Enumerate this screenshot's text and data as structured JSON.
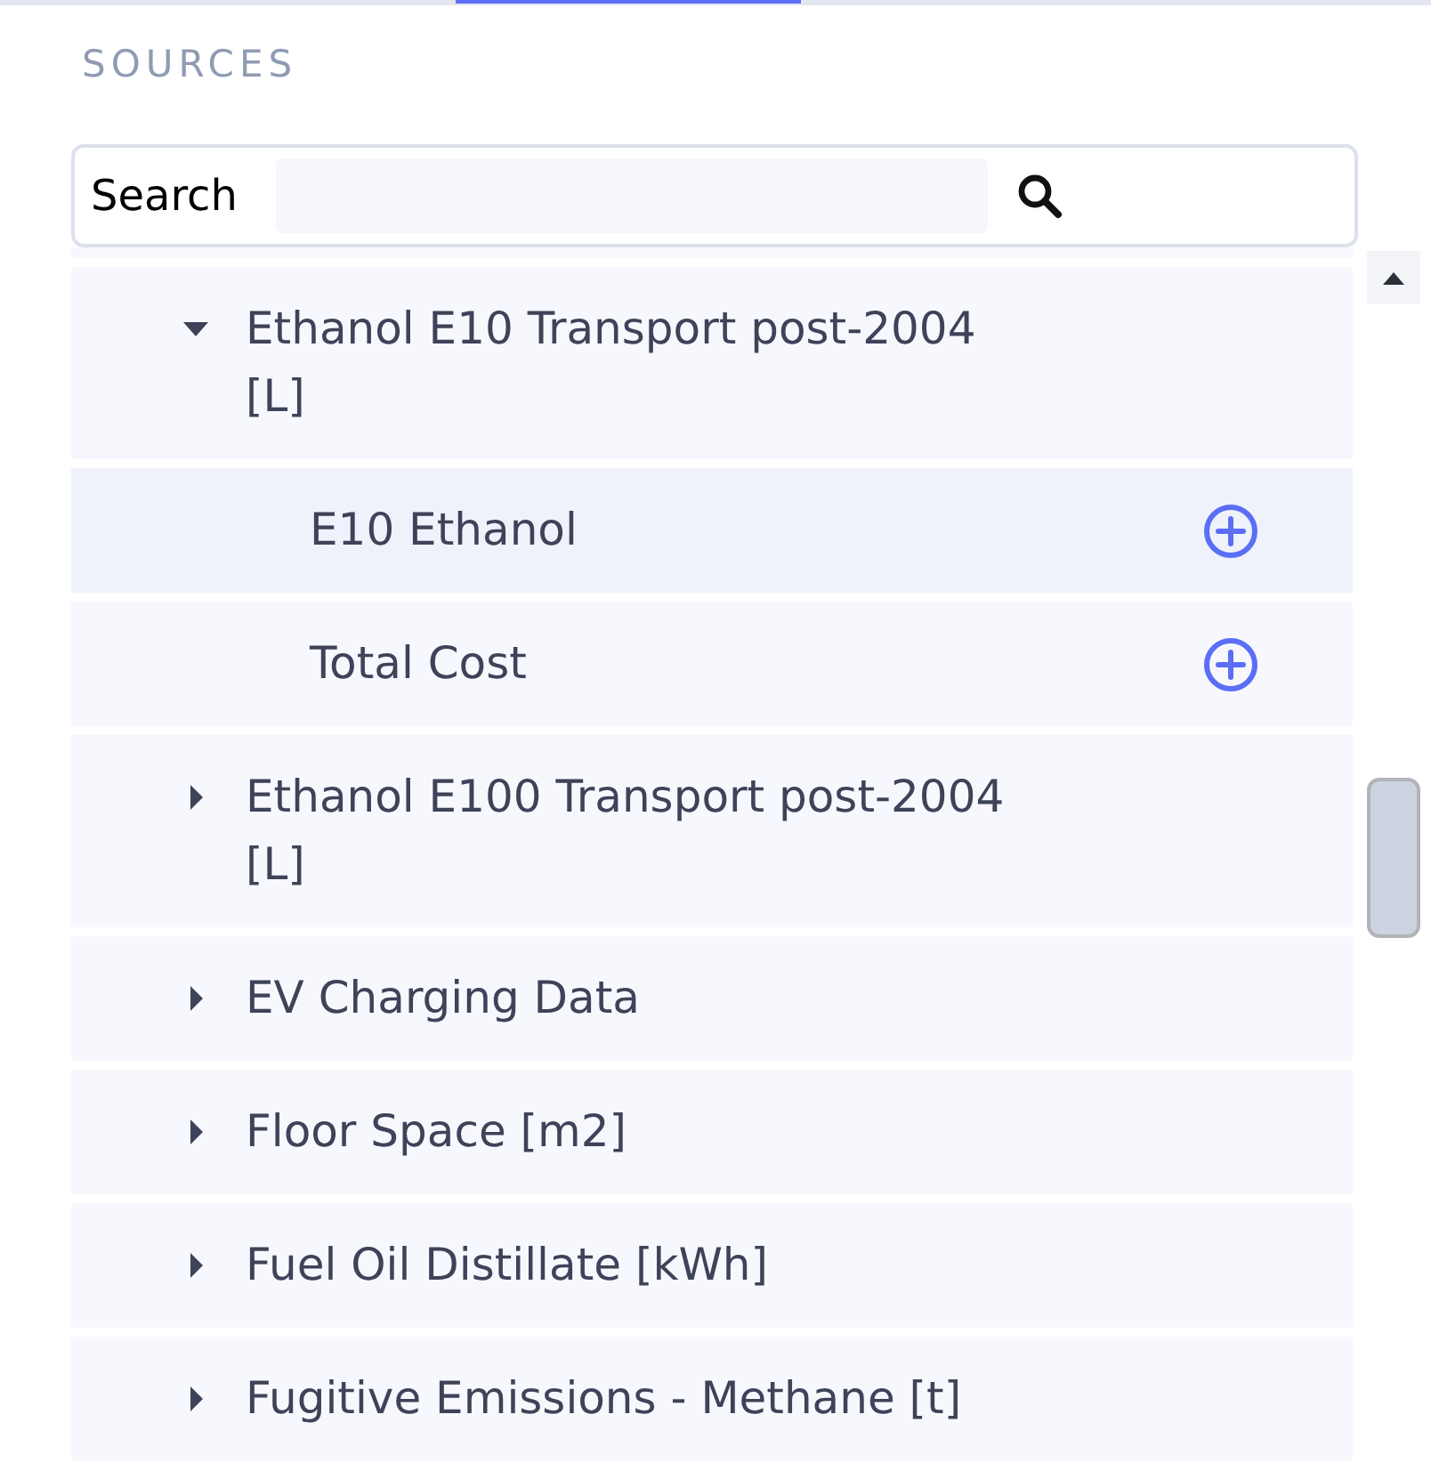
{
  "panel": {
    "title": "SOURCES"
  },
  "search": {
    "label": "Search"
  },
  "tree": {
    "items": [
      {
        "label": "Ethanol E10 Transport post-2004 [L]",
        "expanded": true,
        "children": [
          {
            "label": "E10 Ethanol",
            "selected": true
          },
          {
            "label": "Total Cost",
            "selected": false
          }
        ]
      },
      {
        "label": "Ethanol E100 Transport post-2004 [L]",
        "expanded": false
      },
      {
        "label": "EV Charging Data",
        "expanded": false
      },
      {
        "label": "Floor Space [m2]",
        "expanded": false
      },
      {
        "label": "Fuel Oil Distillate [kWh]",
        "expanded": false
      },
      {
        "label": "Fugitive Emissions - Methane [t]",
        "expanded": false
      }
    ]
  }
}
